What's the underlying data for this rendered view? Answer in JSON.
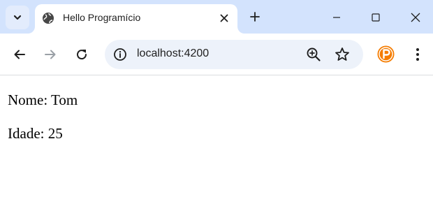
{
  "tab": {
    "title": "Hello Programício"
  },
  "omnibox": {
    "url": "localhost:4200"
  },
  "page": {
    "lines": [
      "Nome: Tom",
      "Idade: 25"
    ]
  },
  "icons": {
    "tab_search": "chevron-down-icon",
    "favicon": "globe-icon",
    "close_tab": "close-icon",
    "new_tab": "plus-icon",
    "minimize": "minimize-icon",
    "maximize": "maximize-icon",
    "close_window": "close-icon",
    "back": "arrow-left-icon",
    "forward": "arrow-right-icon",
    "reload": "reload-icon",
    "site_info": "info-icon",
    "zoom": "zoom-in-icon",
    "bookmark": "star-icon",
    "extension": "extension-icon",
    "menu": "kebab-menu-icon"
  },
  "colors": {
    "tabbar_bg": "#d3e3fd",
    "omnibox_bg": "#edf2fa",
    "extension_orange": "#f57c00"
  }
}
